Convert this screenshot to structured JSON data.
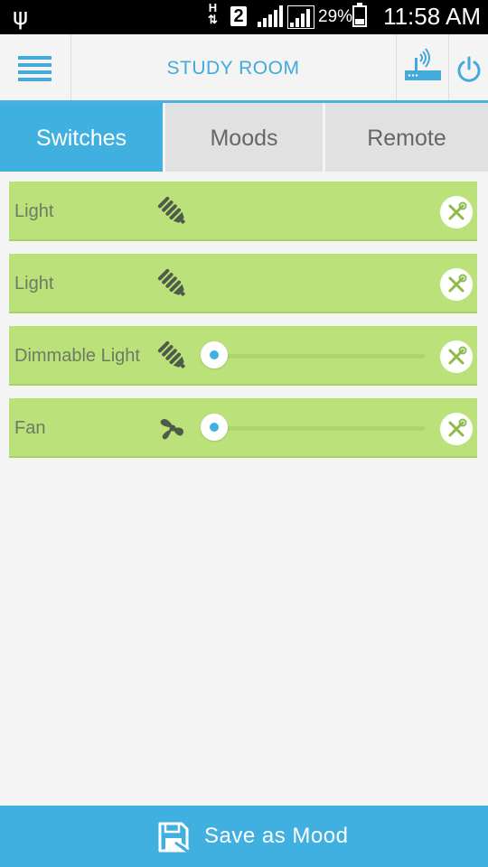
{
  "status_bar": {
    "network_type": "H",
    "sim_slot": "2",
    "battery_percent": "29%",
    "battery_level": 0.29,
    "time": "11:58 AM"
  },
  "app_bar": {
    "title": "STUDY ROOM",
    "menu_icon": "hamburger-menu-icon",
    "router_icon": "wifi-router-icon",
    "power_icon": "power-icon",
    "accent_color": "#44a9db"
  },
  "tabs": [
    {
      "label": "Switches",
      "active": true
    },
    {
      "label": "Moods",
      "active": false
    },
    {
      "label": "Remote",
      "active": false
    }
  ],
  "devices": [
    {
      "label": "Light",
      "icon": "bulb-icon",
      "has_slider": false
    },
    {
      "label": "Light",
      "icon": "bulb-icon",
      "has_slider": false
    },
    {
      "label": "Dimmable Light",
      "icon": "bulb-icon",
      "has_slider": true,
      "level": 0
    },
    {
      "label": "Fan",
      "icon": "fan-icon",
      "has_slider": true,
      "level": 0
    }
  ],
  "row_color": "#bbe27a",
  "bottom_bar": {
    "label": "Save as Mood",
    "icon": "floppy-save-icon",
    "color": "#3fb0e0"
  }
}
